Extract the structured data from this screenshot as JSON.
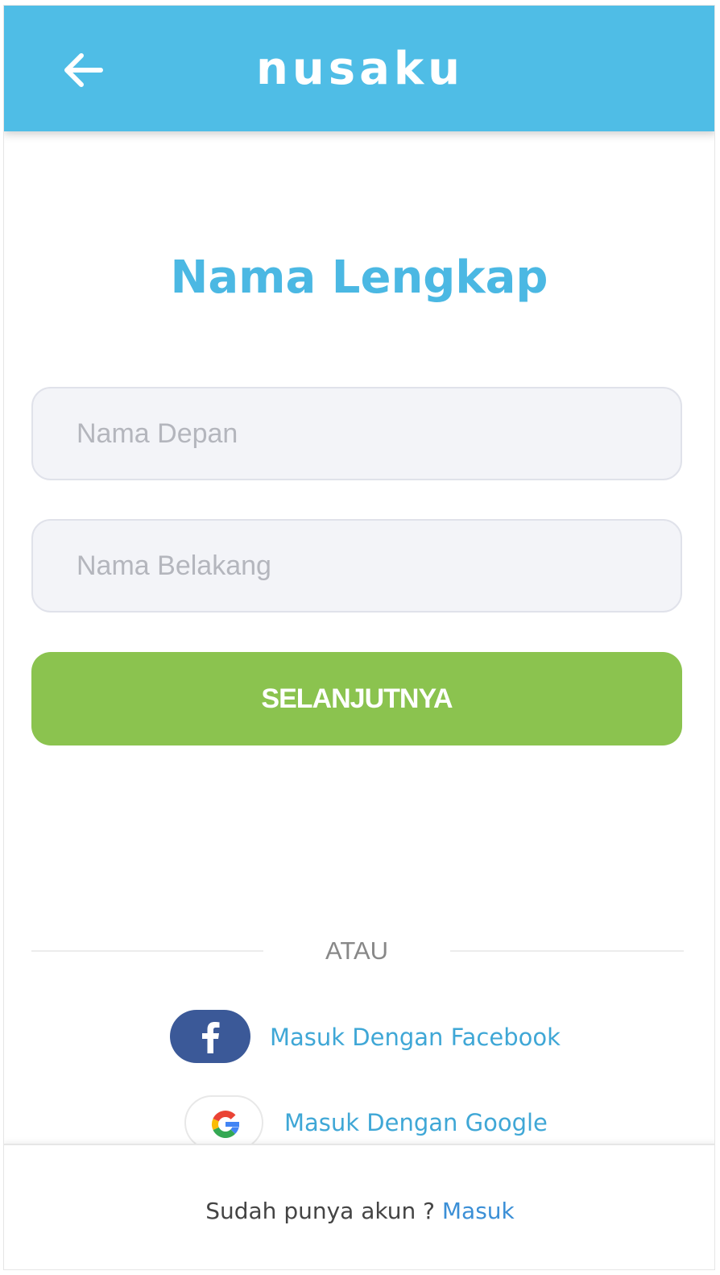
{
  "header": {
    "brand": "nusaku",
    "back_icon": "arrow-left-icon",
    "background": "#4fbde6"
  },
  "main": {
    "title": "Nama Lengkap",
    "first_name_placeholder": "Nama Depan",
    "first_name_value": "",
    "last_name_placeholder": "Nama Belakang",
    "last_name_value": "",
    "next_button_label": "SELANJUTNYA",
    "next_button_color": "#8bc34f"
  },
  "divider": {
    "label": "ATAU"
  },
  "social": {
    "facebook_label": "Masuk Dengan Facebook",
    "facebook_icon": "facebook-icon",
    "facebook_color": "#3b5998",
    "google_label": "Masuk Dengan Google",
    "google_icon": "google-icon"
  },
  "footer": {
    "prompt": "Sudah punya akun ? ",
    "login_link": "Masuk"
  }
}
